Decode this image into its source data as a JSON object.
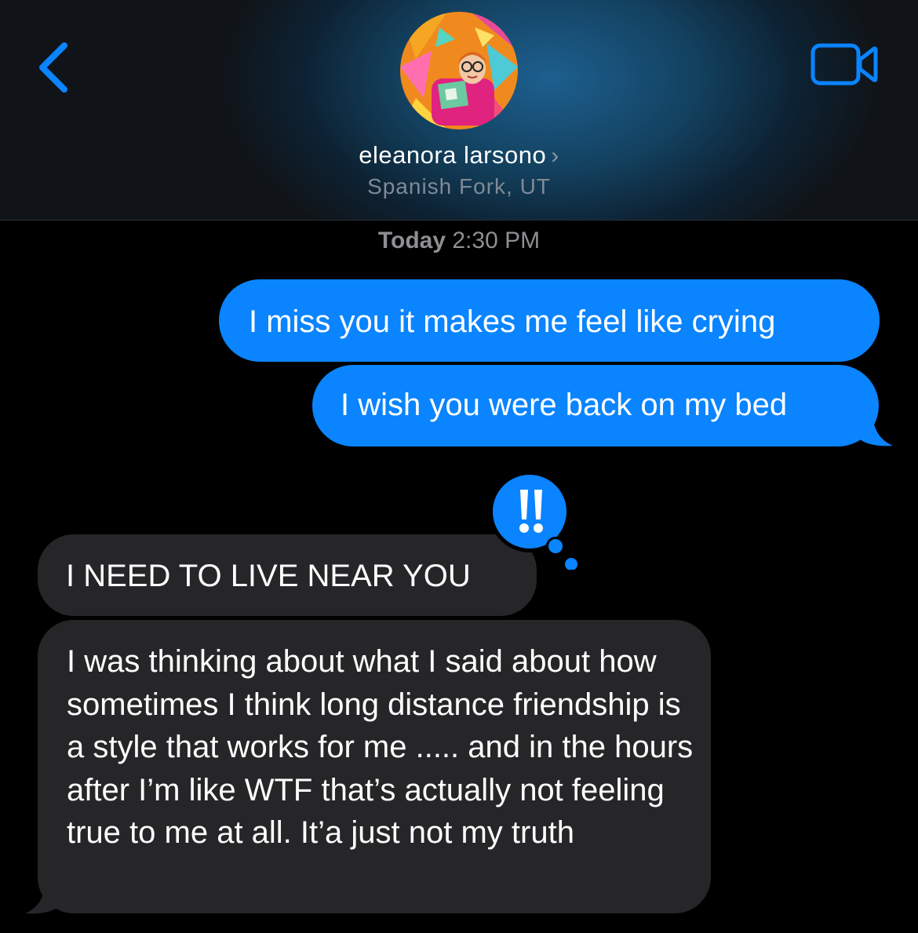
{
  "header": {
    "contact_name": "eleanora larsono",
    "chevron": "›",
    "location": "Spanish Fork, UT",
    "back_icon": "chevron-left-icon",
    "video_icon": "video-camera-icon"
  },
  "conversation": {
    "timestamp_day": "Today",
    "timestamp_time": "2:30 PM",
    "messages": [
      {
        "direction": "sent",
        "text": "I miss you it makes me feel like crying"
      },
      {
        "direction": "sent",
        "text": "I wish you were back on my bed"
      },
      {
        "direction": "received",
        "text": "I NEED TO LIVE NEAR YOU",
        "reaction": "!!"
      },
      {
        "direction": "received",
        "text": "I was thinking about what I said about how sometimes I think long distance friendship is a style that works for me ..... and in the hours after I’m like WTF that’s actually not feeling true to me at all. It’a just not my truth"
      }
    ]
  },
  "colors": {
    "sent_bubble": "#0a84ff",
    "received_bubble": "#262628",
    "accent": "#0a84ff",
    "background": "#000000"
  }
}
